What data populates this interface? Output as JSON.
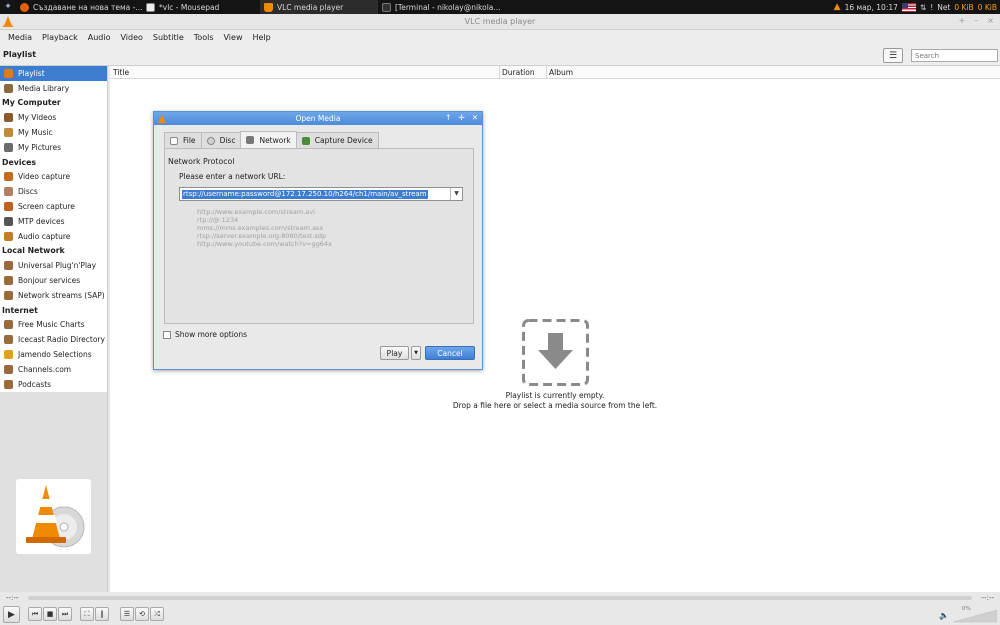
{
  "taskbar": {
    "tasks": [
      "Създаване на нова тема -...",
      "*vlc - Mousepad",
      "VLC media player",
      "[Terminal - nikolay@nikola..."
    ],
    "clock": "16 мар, 10:17",
    "net_label": "Net",
    "net_down": "0 KiB",
    "net_up": "0 KiB"
  },
  "window": {
    "title": "VLC media player",
    "controls": [
      "+",
      "–",
      "×"
    ]
  },
  "menu": [
    "Media",
    "Playback",
    "Audio",
    "Video",
    "Subtitle",
    "Tools",
    "View",
    "Help"
  ],
  "playlist_header": {
    "label": "Playlist",
    "search_placeholder": "Search"
  },
  "sidebar": [
    {
      "type": "item",
      "label": "Playlist",
      "selected": true,
      "color": "#e07b1a"
    },
    {
      "type": "item",
      "label": "Media Library",
      "color": "#8a6a3a"
    },
    {
      "type": "cat",
      "label": "My Computer"
    },
    {
      "type": "item",
      "label": "My Videos",
      "color": "#8a5a2a"
    },
    {
      "type": "item",
      "label": "My Music",
      "color": "#c08a3a"
    },
    {
      "type": "item",
      "label": "My Pictures",
      "color": "#6a6a6a"
    },
    {
      "type": "cat",
      "label": "Devices"
    },
    {
      "type": "item",
      "label": "Video capture",
      "color": "#c86a1a"
    },
    {
      "type": "item",
      "label": "Discs",
      "color": "#b08060"
    },
    {
      "type": "item",
      "label": "Screen capture",
      "color": "#c06020"
    },
    {
      "type": "item",
      "label": "MTP devices",
      "color": "#555555"
    },
    {
      "type": "item",
      "label": "Audio capture",
      "color": "#c87a2a"
    },
    {
      "type": "cat",
      "label": "Local Network"
    },
    {
      "type": "item",
      "label": "Universal Plug'n'Play",
      "color": "#9a6a3a"
    },
    {
      "type": "item",
      "label": "Bonjour services",
      "color": "#9a6a3a"
    },
    {
      "type": "item",
      "label": "Network streams (SAP)",
      "color": "#9a6a3a"
    },
    {
      "type": "cat",
      "label": "Internet"
    },
    {
      "type": "item",
      "label": "Free Music Charts",
      "color": "#9a6a3a"
    },
    {
      "type": "item",
      "label": "Icecast Radio Directory",
      "color": "#9a6a3a"
    },
    {
      "type": "item",
      "label": "Jamendo Selections",
      "color": "#e0a020"
    },
    {
      "type": "item",
      "label": "Channels.com",
      "color": "#9a6a3a"
    },
    {
      "type": "item",
      "label": "Podcasts",
      "color": "#9a6a3a"
    }
  ],
  "columns": [
    "Title",
    "Duration",
    "Album"
  ],
  "empty": {
    "line1": "Playlist is currently empty.",
    "line2": "Drop a file here or select a media source from the left."
  },
  "dialog": {
    "title": "Open Media",
    "tabs": [
      {
        "label": "File",
        "active": false
      },
      {
        "label": "Disc",
        "active": false
      },
      {
        "label": "Network",
        "active": true
      },
      {
        "label": "Capture Device",
        "active": false
      }
    ],
    "section_title": "Network Protocol",
    "url_label": "Please enter a network URL:",
    "url_value": "rtsp://username:password@172.17.250.10/h264/ch1/main/av_stream",
    "examples": [
      "http://www.example.com/stream.avi",
      "rtp://@:1234",
      "mms://mms.examples.com/stream.asx",
      "rtsp://server.example.org:8080/test.sdp",
      "http://www.youtube.com/watch?v=gg64x"
    ],
    "more_options": "Show more options",
    "play_label": "Play",
    "cancel_label": "Cancel"
  },
  "seek": {
    "elapsed": "--:--",
    "remaining": "--:--"
  },
  "volume": "0%",
  "colors": {
    "selection": "#3d7dd0",
    "vlc_orange": "#f08a00"
  }
}
